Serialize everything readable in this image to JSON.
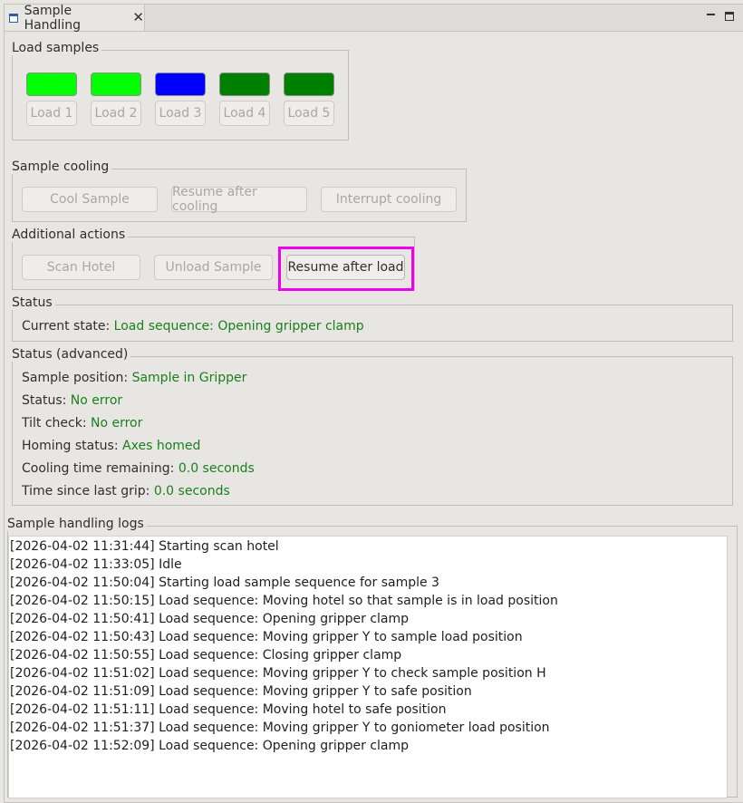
{
  "tab": {
    "title": "Sample Handling",
    "close_glyph": "✕"
  },
  "load_samples": {
    "legend": "Load samples",
    "items": [
      {
        "label": "Load 1",
        "led_color": "#00ff00"
      },
      {
        "label": "Load 2",
        "led_color": "#00ff00"
      },
      {
        "label": "Load 3",
        "led_color": "#0000ff"
      },
      {
        "label": "Load 4",
        "led_color": "#008000"
      },
      {
        "label": "Load 5",
        "led_color": "#008000"
      }
    ]
  },
  "sample_cooling": {
    "legend": "Sample cooling",
    "cool": "Cool Sample",
    "resume": "Resume after cooling",
    "interrupt": "Interrupt cooling"
  },
  "additional_actions": {
    "legend": "Additional actions",
    "scan_hotel": "Scan Hotel",
    "unload_sample": "Unload Sample",
    "resume_after_load": "Resume after load"
  },
  "status": {
    "legend": "Status",
    "current_state_label": "Current state:",
    "current_state_value": "Load sequence: Opening gripper clamp"
  },
  "status_advanced": {
    "legend": "Status (advanced)",
    "rows": [
      {
        "label": "Sample position:",
        "value": "Sample in Gripper"
      },
      {
        "label": "Status:",
        "value": "No error"
      },
      {
        "label": "Tilt check:",
        "value": "No error"
      },
      {
        "label": "Homing status:",
        "value": "Axes homed"
      },
      {
        "label": "Cooling time remaining:",
        "value": "0.0 seconds"
      },
      {
        "label": "Time since last grip:",
        "value": "0.0 seconds"
      }
    ]
  },
  "logs": {
    "legend": "Sample handling logs",
    "lines": [
      "[2026-04-02 11:31:44] Starting scan hotel",
      "[2026-04-02 11:33:05] Idle",
      "[2026-04-02 11:50:04] Starting load sample sequence for sample 3",
      "[2026-04-02 11:50:15] Load sequence: Moving hotel so that sample is in load position",
      "[2026-04-02 11:50:41] Load sequence: Opening gripper clamp",
      "[2026-04-02 11:50:43] Load sequence: Moving gripper Y to sample load position",
      "[2026-04-02 11:50:55] Load sequence: Closing gripper clamp",
      "[2026-04-02 11:51:02] Load sequence: Moving gripper Y to check sample position H",
      "[2026-04-02 11:51:09] Load sequence: Moving gripper Y to safe position",
      "[2026-04-02 11:51:11] Load sequence: Moving hotel to safe position",
      "[2026-04-02 11:51:37] Load sequence: Moving gripper Y to goniometer load position",
      "[2026-04-02 11:52:09] Load sequence: Opening gripper clamp"
    ]
  },
  "colors": {
    "value_green": "#1a7f1a",
    "highlight": "#ee00ee"
  }
}
